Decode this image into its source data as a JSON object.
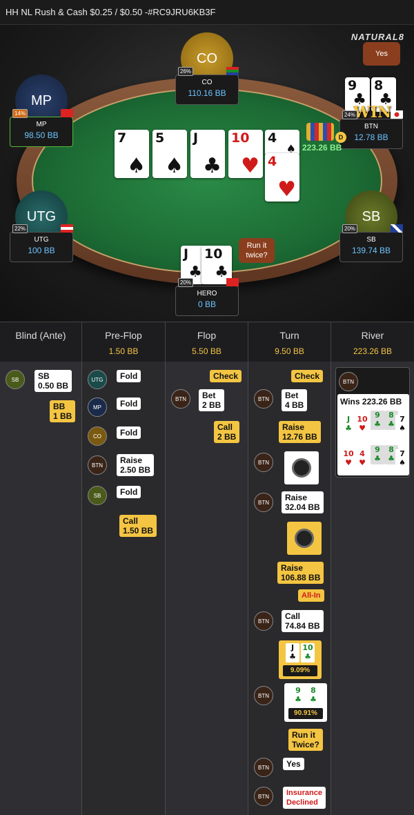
{
  "title": "HH NL Rush & Cash $0.25 / $0.50 -#RC9JRU6KB3F",
  "logo": "NATURAL8",
  "seats": {
    "co": {
      "avatar": "CO",
      "name": "CO",
      "stack": "110.16 BB",
      "pct": "26%"
    },
    "mp": {
      "avatar": "MP",
      "name": "MP",
      "stack": "98.50 BB",
      "pct": "14%"
    },
    "btn": {
      "name": "BTN",
      "stack": "12.78 BB",
      "pct": "24%",
      "bubble": "Yes",
      "win": "WIN",
      "cards": [
        {
          "rank": "9",
          "suit": "♣"
        },
        {
          "rank": "8",
          "suit": "♣"
        }
      ]
    },
    "utg": {
      "avatar": "UTG",
      "name": "UTG",
      "stack": "100 BB",
      "pct": "22%"
    },
    "sb": {
      "avatar": "SB",
      "name": "SB",
      "stack": "139.74 BB",
      "pct": "20%"
    },
    "hero": {
      "name": "HERO",
      "stack": "0 BB",
      "pct": "20%",
      "bubble": "Run it twice?",
      "cards": [
        {
          "rank": "J",
          "suit": "♣"
        },
        {
          "rank": "10",
          "suit": "♣"
        }
      ]
    }
  },
  "pot": "223.26 BB",
  "dealer": "D",
  "board": [
    {
      "rank": "7",
      "suit": "♠",
      "red": false
    },
    {
      "rank": "5",
      "suit": "♠",
      "red": false
    },
    {
      "rank": "J",
      "suit": "♣",
      "red": false
    },
    {
      "rank": "10",
      "suit": "♥",
      "red": true
    },
    {
      "rank": "4",
      "suit": "♠",
      "red": false
    },
    {
      "rank": "4",
      "suit": "♥",
      "red": true
    }
  ],
  "streets": [
    {
      "name": "Blind (Ante)",
      "pot": ""
    },
    {
      "name": "Pre-Flop",
      "pot": "1.50 BB"
    },
    {
      "name": "Flop",
      "pot": "5.50 BB"
    },
    {
      "name": "Turn",
      "pot": "9.50 BB"
    },
    {
      "name": "River",
      "pot": "223.26 BB"
    }
  ],
  "blind_actions": [
    {
      "player": "SB",
      "action": "SB\n0.50 BB"
    },
    {
      "player": "BB",
      "action": "BB\n1 BB"
    }
  ],
  "preflop_actions": [
    {
      "player": "UTG",
      "action": "Fold"
    },
    {
      "player": "MP",
      "action": "Fold"
    },
    {
      "player": "CO",
      "action": "Fold"
    },
    {
      "player": "BTN",
      "action": "Raise\n2.50 BB"
    },
    {
      "player": "SB",
      "action": "Fold"
    },
    {
      "player": "BB",
      "action": "Call\n1.50 BB"
    }
  ],
  "flop_actions": [
    {
      "player": "BB",
      "action": "Check"
    },
    {
      "player": "BTN",
      "action": "Bet\n2 BB"
    },
    {
      "player": "BB",
      "action": "Call\n2 BB"
    }
  ],
  "turn_actions": [
    {
      "player": "BB",
      "action": "Check"
    },
    {
      "player": "BTN",
      "action": "Bet\n4 BB"
    },
    {
      "player": "BB",
      "action": "Raise\n12.76 BB"
    },
    {
      "player": "BTN",
      "action": "timer"
    },
    {
      "player": "BTN",
      "action": "Raise\n32.04 BB"
    },
    {
      "player": "BB",
      "action": "timer"
    },
    {
      "player": "BB",
      "action": "Raise\n106.88 BB",
      "badge": "All-In"
    },
    {
      "player": "BTN",
      "action": "Call\n74.84 BB"
    },
    {
      "player": "BB",
      "equity": "9.09%"
    },
    {
      "player": "BTN",
      "equity": "90.91%"
    },
    {
      "player": "BB",
      "action": "Run it\nTwice?"
    },
    {
      "player": "BTN",
      "action": "Yes"
    },
    {
      "player": "BTN",
      "action": "Insurance\nDeclined"
    }
  ],
  "river": {
    "player": "BTN",
    "result": "Wins 223.26 BB"
  },
  "colors": {
    "accent": "#f4c542",
    "stack": "#6cc4ff",
    "felt": "#1c6b34",
    "bubble": "#8a3e1e"
  }
}
